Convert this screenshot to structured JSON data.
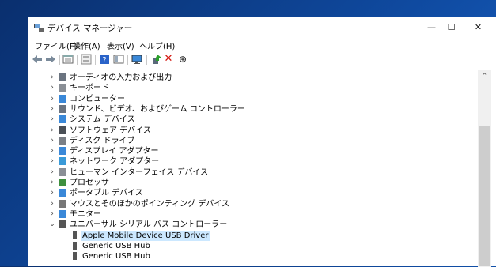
{
  "window": {
    "title": "デバイス マネージャー",
    "minimize": "—",
    "maximize": "☐",
    "close": "✕"
  },
  "menu": [
    "ファイル(F)",
    "操作(A)",
    "表示(V)",
    "ヘルプ(H)"
  ],
  "toolbar": {
    "icons": [
      "back-arrow-icon",
      "forward-arrow-icon",
      "properties-icon",
      "show-hidden-icon",
      "help-icon",
      "view-icon",
      "monitor-icon",
      "update-driver-icon",
      "uninstall-icon",
      "scan-hardware-icon"
    ],
    "uninstall_glyph": "✕",
    "scan_glyph": "⊕"
  },
  "tree": {
    "categories": [
      {
        "label": "オーディオの入力および出力",
        "icon": "speaker-icon",
        "expanded": false
      },
      {
        "label": "キーボード",
        "icon": "keyboard-icon",
        "expanded": false
      },
      {
        "label": "コンピューター",
        "icon": "computer-icon",
        "expanded": false
      },
      {
        "label": "サウンド、ビデオ、およびゲーム コントローラー",
        "icon": "speaker-icon",
        "expanded": false
      },
      {
        "label": "システム デバイス",
        "icon": "system-icon",
        "expanded": false
      },
      {
        "label": "ソフトウェア デバイス",
        "icon": "device-icon",
        "expanded": false
      },
      {
        "label": "ディスク ドライブ",
        "icon": "disk-icon",
        "expanded": false
      },
      {
        "label": "ディスプレイ アダプター",
        "icon": "display-icon",
        "expanded": false
      },
      {
        "label": "ネットワーク アダプター",
        "icon": "network-icon",
        "expanded": false
      },
      {
        "label": "ヒューマン インターフェイス デバイス",
        "icon": "hid-icon",
        "expanded": false
      },
      {
        "label": "プロセッサ",
        "icon": "processor-icon",
        "expanded": false
      },
      {
        "label": "ポータブル デバイス",
        "icon": "portable-icon",
        "expanded": false
      },
      {
        "label": "マウスとそのほかのポインティング デバイス",
        "icon": "mouse-icon",
        "expanded": false
      },
      {
        "label": "モニター",
        "icon": "monitor-icon",
        "expanded": false
      },
      {
        "label": "ユニバーサル シリアル バス コントローラー",
        "icon": "usb-icon",
        "expanded": true
      }
    ],
    "children": [
      {
        "label": "Apple Mobile Device USB Driver",
        "icon": "usb-plug-icon",
        "selected": true
      },
      {
        "label": "Generic USB Hub",
        "icon": "usb-plug-icon",
        "selected": false
      },
      {
        "label": "Generic USB Hub",
        "icon": "usb-plug-icon",
        "selected": false
      }
    ],
    "collapsed_glyph": "›",
    "expanded_glyph": "⌄"
  },
  "scrollbar": {
    "up_glyph": "⌃"
  },
  "colors": {
    "selection": "#cce8ff",
    "desktop": "#0f4aa0",
    "remove": "#d4160e",
    "help": "#2a63c9"
  }
}
